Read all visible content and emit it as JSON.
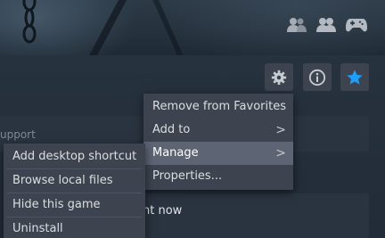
{
  "section": {
    "support_label": "upport"
  },
  "behind_text": "nt now",
  "main_menu": {
    "items": [
      {
        "label": "Remove from Favorites",
        "has_submenu": false
      },
      {
        "label": "Add to",
        "has_submenu": true
      },
      {
        "label": "Manage",
        "has_submenu": true,
        "highlighted": true
      },
      {
        "label": "Properties...",
        "has_submenu": false
      }
    ]
  },
  "manage_submenu": {
    "items": [
      {
        "label": "Add desktop shortcut"
      },
      {
        "label": "Browse local files"
      },
      {
        "label": "Hide this game"
      },
      {
        "label": "Uninstall"
      }
    ]
  },
  "chevron_glyph": ">",
  "colors": {
    "favorite_star": "#1a9fff",
    "menu_bg": "#3d4450",
    "menu_highlight": "#5d6575"
  },
  "icons": {
    "hero": [
      "friends-playing-icon",
      "friends-icon",
      "controller-icon"
    ],
    "toolbar": [
      "gear-icon",
      "info-icon",
      "star-icon"
    ]
  }
}
